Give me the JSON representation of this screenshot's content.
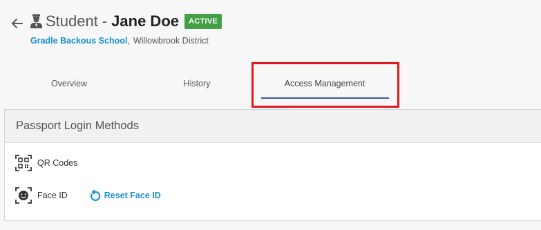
{
  "header": {
    "back_icon": "arrow-left-icon",
    "student_icon": "student-icon",
    "title_prefix": "Student",
    "title_separator": "-",
    "student_name": "Jane Doe",
    "status": "ACTIVE",
    "status_color": "#43a047",
    "school": "Gradle Backous School",
    "separator": ",",
    "district": "Willowbrook District"
  },
  "tabs": [
    {
      "label": "Overview",
      "active": false
    },
    {
      "label": "History",
      "active": false
    },
    {
      "label": "Access Management",
      "active": true
    }
  ],
  "colors": {
    "link": "#1a8fd0",
    "tab_underline": "#3f51b5",
    "highlight": "#e3161c"
  },
  "card": {
    "title": "Passport Login Methods",
    "methods": [
      {
        "label": "QR Codes",
        "icon": "qr-code-icon"
      },
      {
        "label": "Face ID",
        "icon": "face-id-icon",
        "action_label": "Reset Face ID",
        "action_icon": "reset-icon"
      }
    ]
  }
}
